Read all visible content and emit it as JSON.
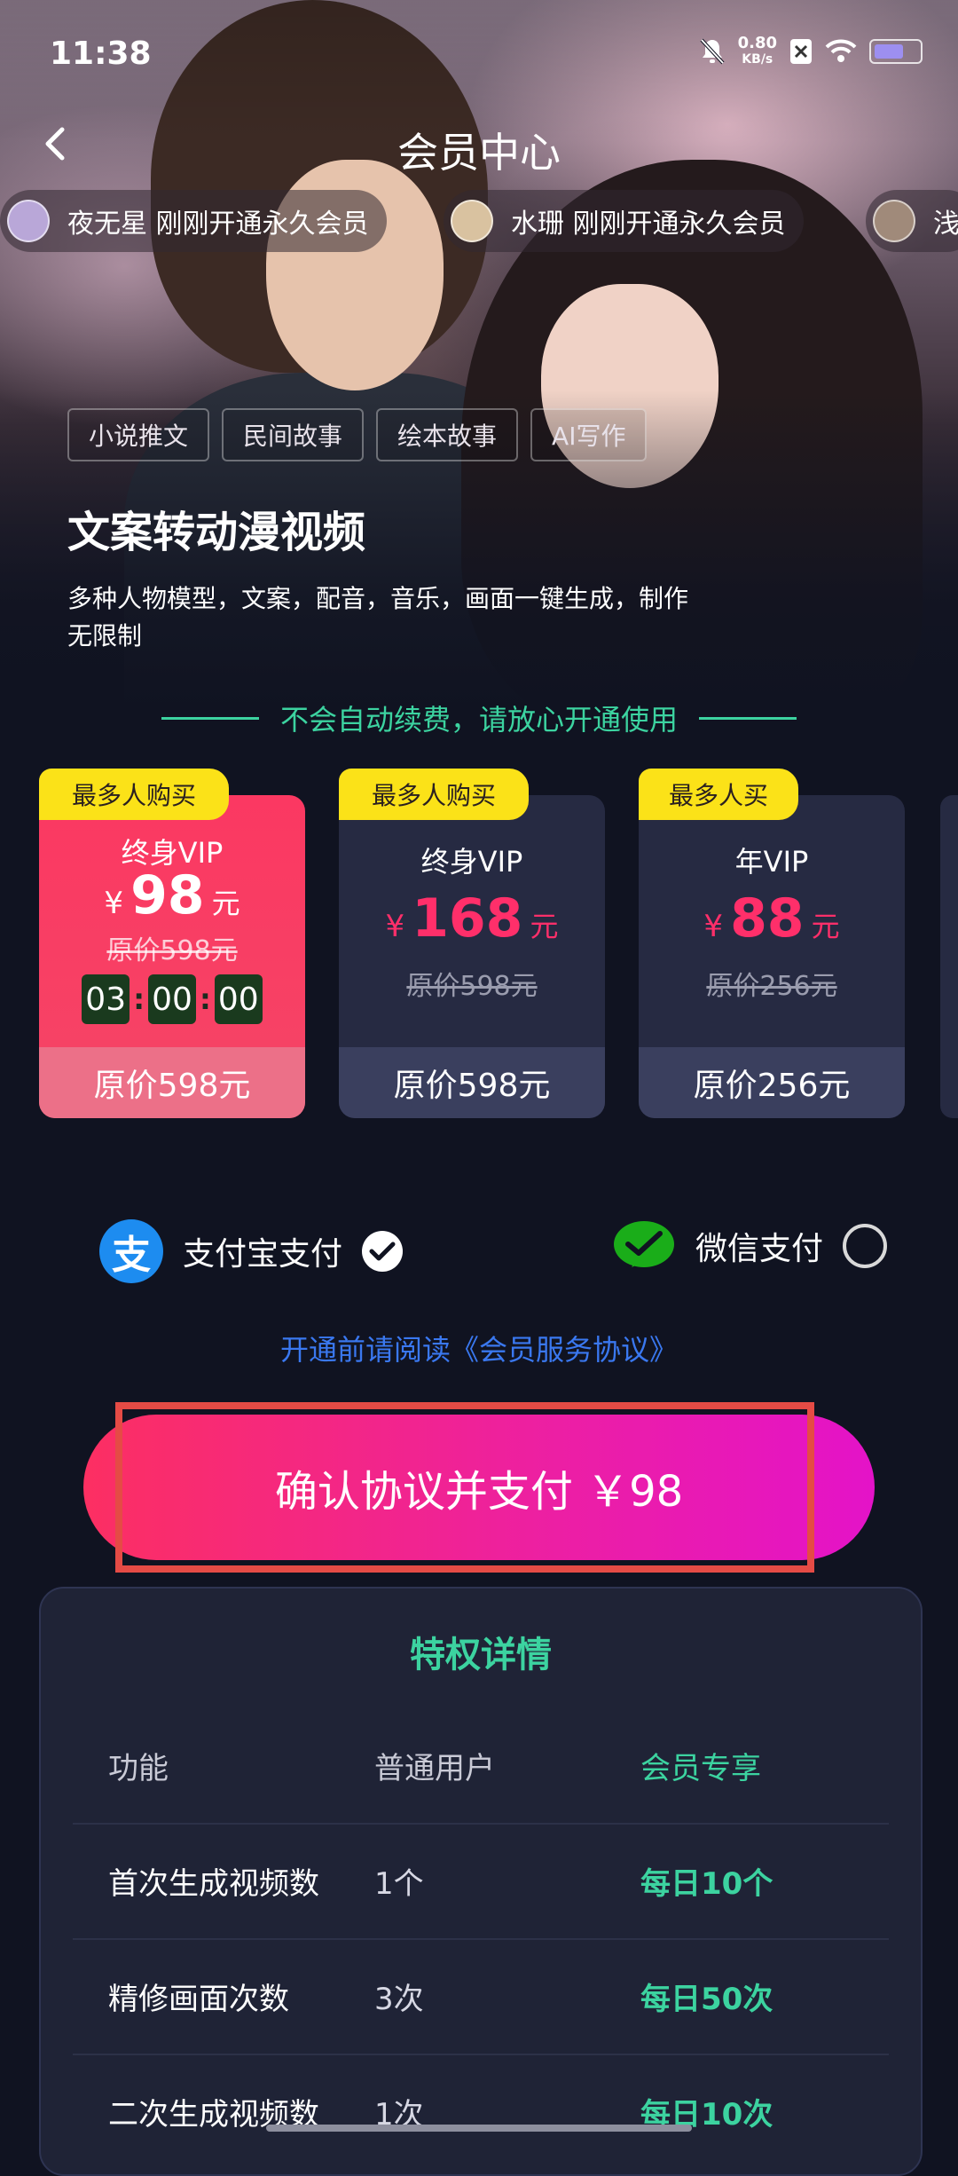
{
  "status_bar": {
    "time": "11:38",
    "net_speed": "0.80",
    "net_unit": "KB/s"
  },
  "nav": {
    "title": "会员中心"
  },
  "ticker": [
    {
      "name": "夜无星",
      "text": "刚刚开通永久会员"
    },
    {
      "name": "水珊",
      "text": "刚刚开通永久会员"
    },
    {
      "name": "",
      "text": "浅"
    }
  ],
  "tags": [
    "小说推文",
    "民间故事",
    "绘本故事",
    "AI写作"
  ],
  "headline": "文案转动漫视频",
  "description": "多种人物模型，文案，配音，音乐，画面一键生成，制作无限制",
  "notice": "不会自动续费，请放心开通使用",
  "plans": [
    {
      "badge": "最多人购买",
      "name": "终身VIP",
      "currency": "¥",
      "price": "98",
      "unit": "元",
      "original": "原价598元",
      "timer": [
        "03",
        "00",
        "00"
      ],
      "footer": "原价598元",
      "selected": true
    },
    {
      "badge": "最多人购买",
      "name": "终身VIP",
      "currency": "¥",
      "price": "168",
      "unit": "元",
      "original": "原价598元",
      "footer": "原价598元",
      "selected": false
    },
    {
      "badge": "最多人买",
      "name": "年VIP",
      "currency": "¥",
      "price": "88",
      "unit": "元",
      "original": "原价256元",
      "footer": "原价256元",
      "selected": false
    }
  ],
  "payment": {
    "alipay": {
      "icon": "alipay-icon",
      "label": "支付宝支付",
      "selected": true
    },
    "wechat": {
      "icon": "wechat-icon",
      "label": "微信支付",
      "selected": false
    }
  },
  "agreement": "开通前请阅读《会员服务协议》",
  "cta": "确认协议并支付 ￥98",
  "privileges": {
    "title": "特权详情",
    "header": [
      "功能",
      "普通用户",
      "会员专享"
    ],
    "rows": [
      [
        "首次生成视频数",
        "1个",
        "每日10个"
      ],
      [
        "精修画面次数",
        "3次",
        "每日50次"
      ],
      [
        "二次生成视频数",
        "1次",
        "每日10次"
      ]
    ]
  },
  "colors": {
    "accent_green": "#3cd3a0",
    "accent_pink": "#fb3862",
    "badge_yellow": "#fbe218",
    "link_blue": "#3a78f0"
  }
}
